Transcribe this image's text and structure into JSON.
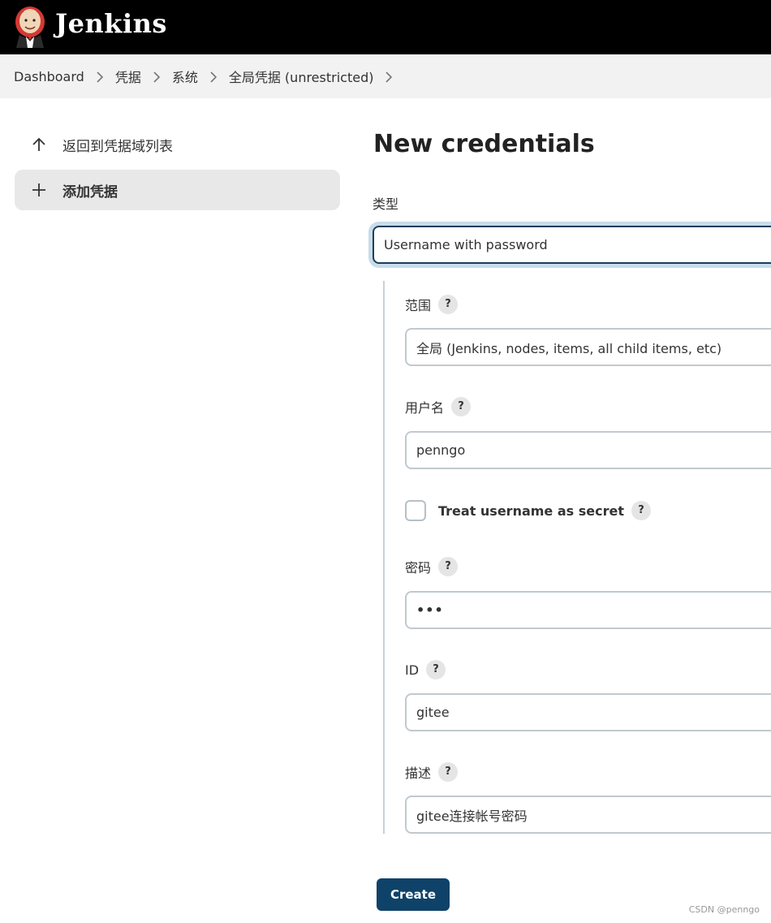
{
  "header": {
    "brand": "Jenkins"
  },
  "breadcrumb": [
    "Dashboard",
    "凭据",
    "系统",
    "全局凭据 (unrestricted)"
  ],
  "sidebar": {
    "back_label": "返回到凭据域列表",
    "add_label": "添加凭据"
  },
  "main": {
    "title": "New credentials",
    "type_label": "类型",
    "type_value": "Username with password",
    "scope_label": "范围",
    "scope_value": "全局 (Jenkins, nodes, items, all child items, etc)",
    "username_label": "用户名",
    "username_value": "penngo",
    "treat_secret_label": "Treat username as secret",
    "treat_secret_checked": false,
    "password_label": "密码",
    "password_value": "•••",
    "id_label": "ID",
    "id_value": "gitee",
    "desc_label": "描述",
    "desc_value": "gitee连接帐号密码",
    "help_glyph": "?",
    "create_label": "Create"
  },
  "watermark": "CSDN @penngo",
  "colors": {
    "header_bg": "#000000",
    "breadcrumb_bg": "#f2f2f2",
    "primary_button": "#0f4268",
    "focus_ring": "#c8dcea"
  },
  "icons": {
    "logo": "jenkins-butler-logo",
    "back": "arrow-up-icon",
    "add": "plus-icon",
    "separator": "chevron-right-icon"
  }
}
